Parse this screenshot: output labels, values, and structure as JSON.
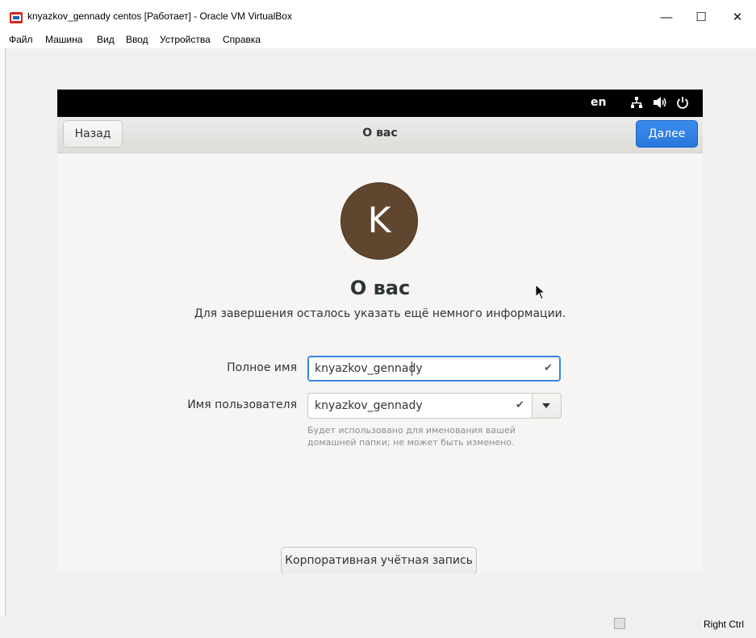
{
  "window": {
    "title": "knyazkov_gennady centos [Работает] - Oracle VM VirtualBox",
    "minimize_glyph": "—",
    "maximize_glyph": "☐",
    "close_glyph": "✕"
  },
  "menu": {
    "items": [
      "Файл",
      "Машина",
      "Вид",
      "Ввод",
      "Устройства",
      "Справка"
    ]
  },
  "guest": {
    "topbar": {
      "language": "en",
      "icons": [
        "network-icon",
        "volume-icon",
        "power-icon"
      ]
    },
    "header": {
      "back_label": "Назад",
      "title": "О вас",
      "next_label": "Далее"
    },
    "avatar_letter": "K",
    "avatar_color": "#61462f",
    "heading": "О вас",
    "subtitle": "Для завершения осталось указать ещё немного информации.",
    "fullname": {
      "label": "Полное имя",
      "value": "knyazkov_gennady"
    },
    "username": {
      "label": "Имя пользователя",
      "value": "knyazkov_gennady"
    },
    "hint": "Будет использовано для именования вашей домашней папки; не может быть изменено.",
    "enterprise_label": "Корпоративная учётная запись",
    "accent_color": "#3584e4"
  },
  "statusbar": {
    "host_key": "Right Ctrl",
    "icons": [
      "disk-icon",
      "optical-drive-icon",
      "audio-icon",
      "network-adapter-icon",
      "usb-icon",
      "shared-folders-icon",
      "display-icon",
      "recording-icon",
      "cpu-icon",
      "mouse-integration-icon",
      "host-key-icon"
    ]
  }
}
